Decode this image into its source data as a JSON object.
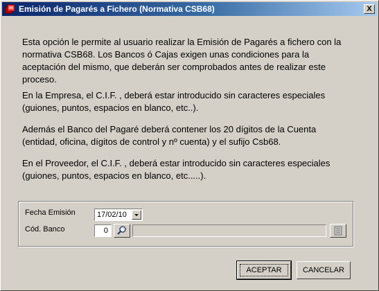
{
  "window": {
    "title": "Emisión de Pagarés a Fichero (Normativa CSB68)",
    "close_label": "X"
  },
  "info": {
    "p1": "Esta opción le permite al  usuario realizar la Emisión de Pagarés a fichero con la normativa  CSB68.  Los Bancos  ó  Cajas  exigen unas condiciones para la aceptación del mismo, que deberán ser comprobados antes de realizar  este proceso.",
    "p2": "En la Empresa, el C.I.F. ,  deberá estar introducido  sin caracteres especiales (guiones, puntos, espacios en blanco, etc..).",
    "p3": "Además el Banco del Pagaré  deberá  contener  los  20  dígitos  de la Cuenta (entidad, oficina, dígitos de control y nº cuenta) y el sufijo Csb68.",
    "p4": "En el Proveedor, el C.I.F. ,  deberá estar introducido sin caracteres especiales (guiones, puntos, espacios en blanco, etc.....)."
  },
  "form": {
    "fecha_label": "Fecha Emisión",
    "fecha_value": "17/02/10",
    "banco_label": "Cód. Banco",
    "banco_value": "0",
    "banco_name": ""
  },
  "buttons": {
    "accept": "ACEPTAR",
    "cancel": "CANCELAR"
  },
  "icons": {
    "app": "document-icon",
    "search": "magnifier-icon",
    "list": "list-icon",
    "dropdown": "chevron-down-icon"
  }
}
